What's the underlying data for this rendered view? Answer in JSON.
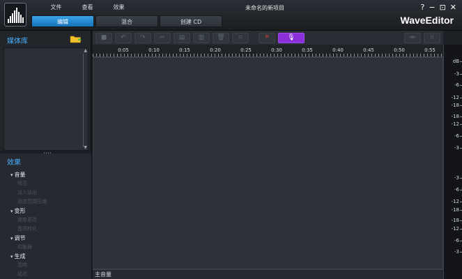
{
  "menu": [
    "文件",
    "查看",
    "效果"
  ],
  "window_title": "未命名的新项目",
  "window_controls": [
    "?",
    "−",
    "⊡",
    "✕"
  ],
  "tabs": [
    {
      "label": "编辑",
      "active": true
    },
    {
      "label": "混合",
      "active": false
    },
    {
      "label": "创建 CD",
      "active": false
    }
  ],
  "brand": "WaveEditor",
  "media_library": {
    "title": "媒体库"
  },
  "effects": {
    "title": "效果",
    "groups": [
      {
        "label": "音量",
        "items": [
          "规范",
          "淡入淡出",
          "动态范围压缩"
        ]
      },
      {
        "label": "变形",
        "items": [
          "速度更改",
          "音高转化"
        ]
      },
      {
        "label": "调节",
        "items": [
          "均衡器"
        ]
      },
      {
        "label": "生成",
        "items": [
          "混响",
          "延迟"
        ]
      }
    ]
  },
  "ruler": {
    "ticks": [
      "0:05",
      "0:10",
      "0:15",
      "0:20",
      "0:25",
      "0:30",
      "0:35",
      "0:40",
      "0:45",
      "0:50",
      "0:55"
    ]
  },
  "db_scale": {
    "unit": "dB",
    "labels": [
      "-3",
      "-6",
      "-12",
      "-18",
      "-18",
      "-12",
      "-6",
      "-3",
      "-3",
      "-6",
      "-12",
      "-18",
      "-18",
      "-12",
      "-6",
      "-3"
    ]
  },
  "master_track": {
    "label": "主音量"
  },
  "colors": {
    "accent": "#2b8fdc",
    "mic_button": "#8a2fd8",
    "section_title": "#4ab0ff"
  }
}
